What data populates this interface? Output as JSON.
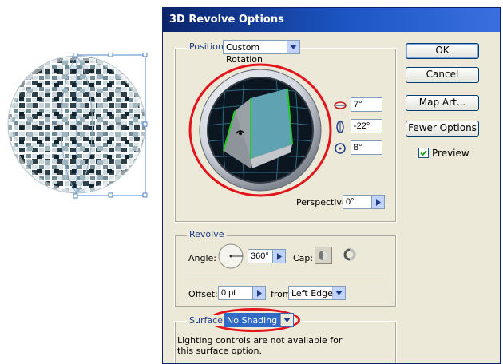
{
  "dialog": {
    "title": "3D Revolve Options",
    "position": {
      "label": "Position:",
      "value": "Custom Rotation",
      "x_rotation": "7°",
      "y_rotation": "-22°",
      "z_rotation": "8°",
      "perspective_label": "Perspective:",
      "perspective_value": "0°"
    },
    "revolve": {
      "label": "Revolve",
      "angle_label": "Angle:",
      "angle_value": "360°",
      "cap_label": "Cap:",
      "offset_label": "Offset:",
      "offset_value": "0 pt",
      "from_label": "from",
      "from_value": "Left Edge"
    },
    "surface": {
      "label": "Surface:",
      "value": "No Shading",
      "note": "Lighting controls are not available for this surface option."
    },
    "buttons": {
      "ok": "OK",
      "cancel": "Cancel",
      "map_art": "Map Art...",
      "fewer_options": "Fewer Options"
    },
    "preview_label": "Preview",
    "preview_checked": true
  },
  "colors": {
    "title_bar": "#0a246a",
    "dialog_bg": "#ece9d8",
    "highlight_red": "#e3141b",
    "cube_face": "#5fa3b2",
    "cube_edge": "#22cc22",
    "label_blue": "#1f3d8a"
  }
}
